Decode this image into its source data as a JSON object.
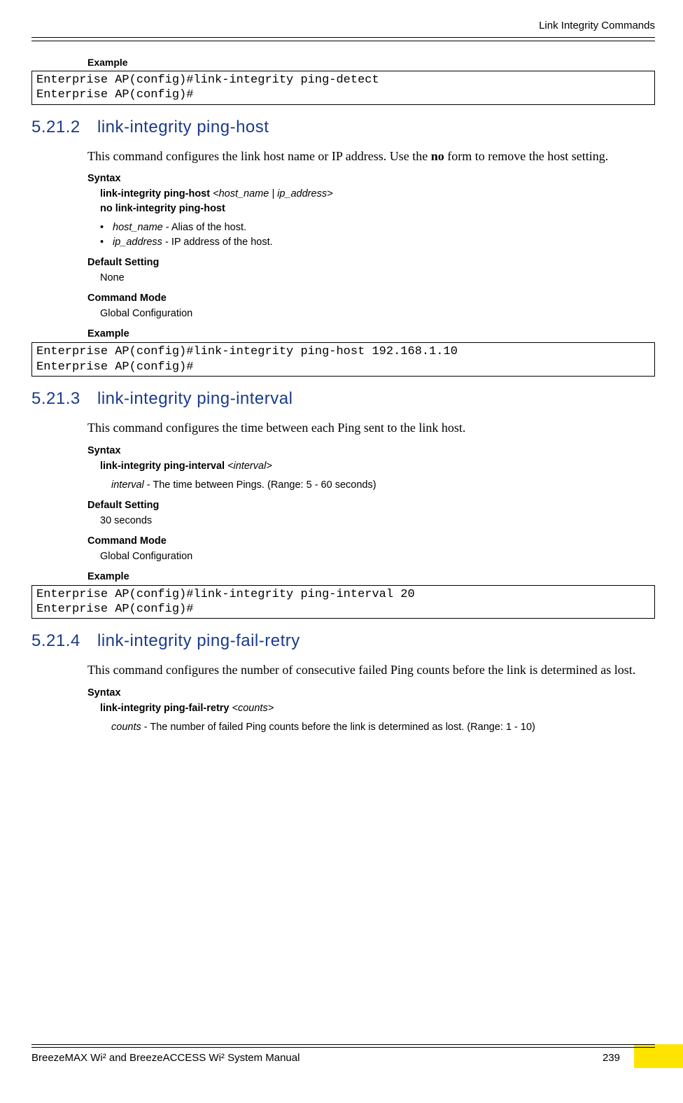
{
  "header": {
    "running": "Link Integrity Commands"
  },
  "labels": {
    "example": "Example",
    "syntax": "Syntax",
    "default_setting": "Default Setting",
    "command_mode": "Command Mode"
  },
  "code1": "Enterprise AP(config)#link-integrity ping-detect\nEnterprise AP(config)#",
  "s2": {
    "num": "5.21.2",
    "title": "link-integrity ping-host",
    "desc_pre": "This command configures the link host name or IP address. Use the ",
    "desc_bold": "no",
    "desc_post": " form to remove the host setting.",
    "syntax_line1_b": "link-integrity ping-host ",
    "syntax_line1_i": "<host_name | ip_address>",
    "syntax_line2_b": "no link-integrity ping-host",
    "bullet1_i": "host_name",
    "bullet1_t": " - Alias of the host.",
    "bullet2_i": "ip_address",
    "bullet2_t": " - IP address of the host.",
    "default": "None",
    "mode": "Global Configuration",
    "code": "Enterprise AP(config)#link-integrity ping-host 192.168.1.10\nEnterprise AP(config)#"
  },
  "s3": {
    "num": "5.21.3",
    "title": "link-integrity ping-interval",
    "desc": "This command configures the time between each Ping sent to the link host.",
    "syntax_b": "link-integrity ping-interval ",
    "syntax_i": "<interval>",
    "param_i": "interval",
    "param_t": " - The time between Pings. (Range: 5 - 60 seconds)",
    "default": "30 seconds",
    "mode": "Global Configuration",
    "code": "Enterprise AP(config)#link-integrity ping-interval 20\nEnterprise AP(config)#"
  },
  "s4": {
    "num": "5.21.4",
    "title": "link-integrity ping-fail-retry",
    "desc": "This command configures the number of consecutive failed Ping counts before the link is determined as lost.",
    "syntax_b": "link-integrity ping-fail-retry ",
    "syntax_i": "<counts>",
    "param_i": "counts",
    "param_t": " - The number of failed Ping counts before the link is determined as lost. (Range: 1 - 10)"
  },
  "footer": {
    "manual": "BreezeMAX Wi² and BreezeACCESS Wi² System Manual",
    "page": "239"
  }
}
